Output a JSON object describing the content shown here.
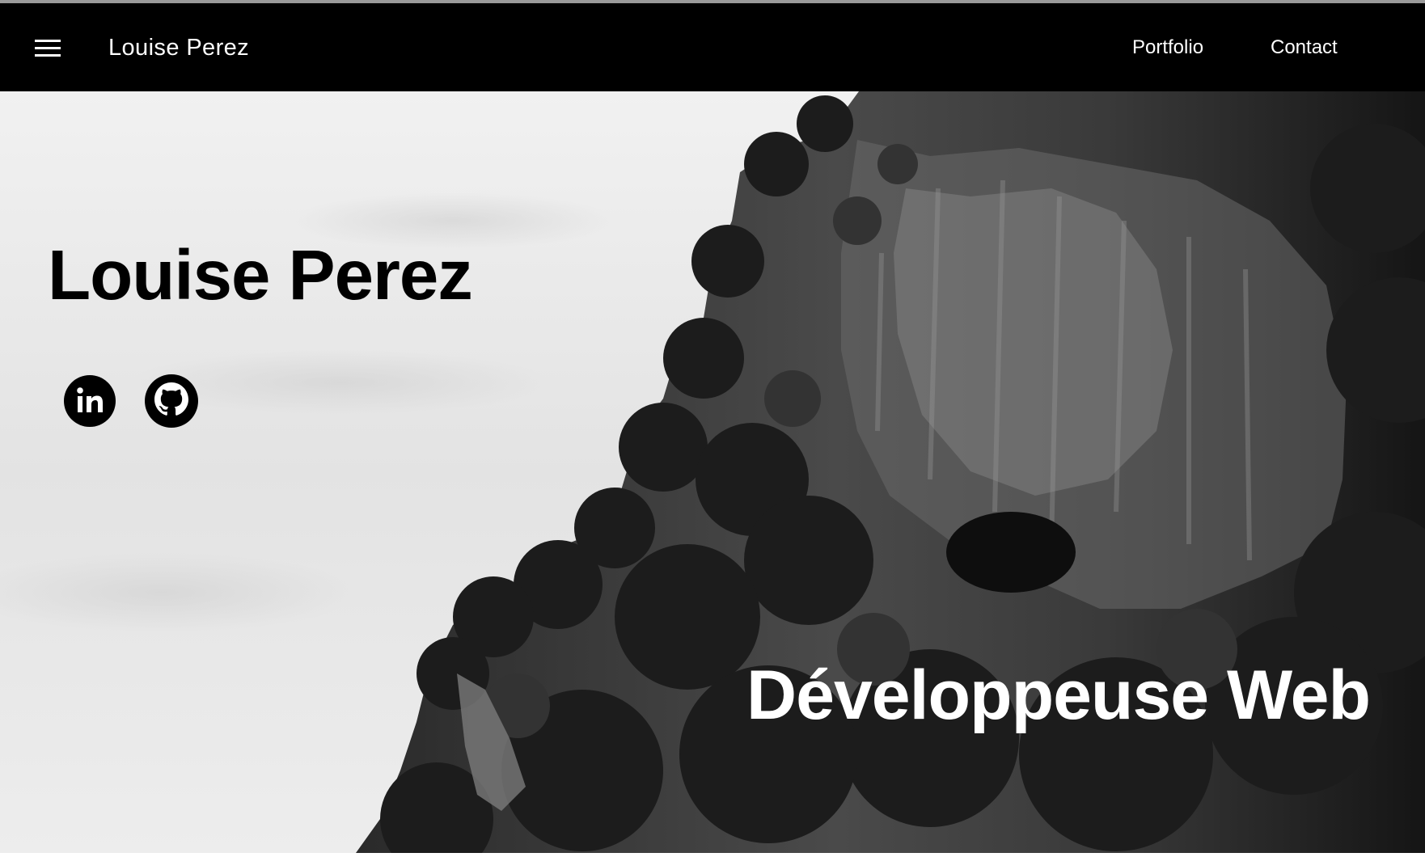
{
  "navbar": {
    "menu_icon": "hamburger-menu-icon",
    "brand": "Louise Perez",
    "links": [
      {
        "label": "Portfolio"
      },
      {
        "label": "Contact"
      }
    ]
  },
  "hero": {
    "background": "black-and-white photo of a jungle-covered limestone cliff",
    "title": "Louise Perez",
    "subtitle": "Développeuse Web",
    "social": [
      {
        "icon": "linkedin-icon"
      },
      {
        "icon": "github-icon"
      }
    ]
  },
  "colors": {
    "navbar_bg": "#000000",
    "nav_text": "#ffffff",
    "title_text": "#000000",
    "subtitle_text": "#ffffff"
  }
}
